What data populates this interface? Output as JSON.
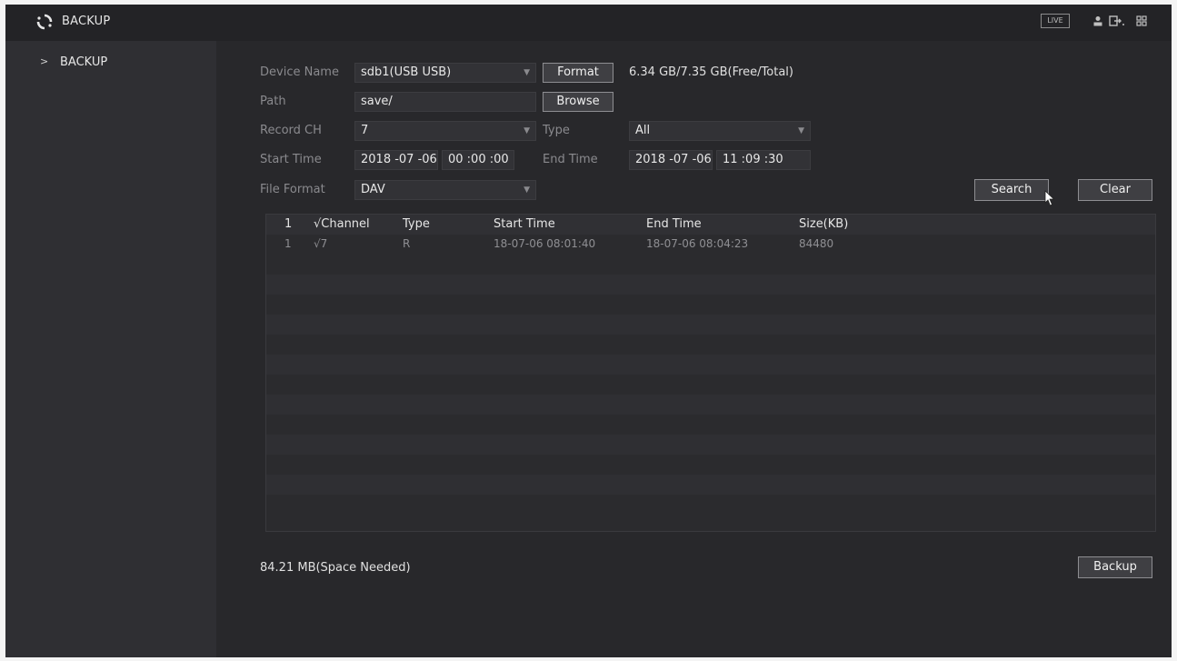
{
  "titlebar": {
    "title": "BACKUP",
    "live_label": "LIVE",
    "icons": [
      "refresh-logo-icon",
      "user-icon",
      "logout-icon",
      "grid-icon"
    ]
  },
  "sidebar": {
    "items": [
      {
        "label": "BACKUP",
        "chevron": ">"
      }
    ]
  },
  "form": {
    "device_name_label": "Device Name",
    "device_name_value": "sdb1(USB USB)",
    "format_button": "Format",
    "capacity_text": "6.34 GB/7.35 GB(Free/Total)",
    "path_label": "Path",
    "path_value": "save/",
    "browse_button": "Browse",
    "record_ch_label": "Record CH",
    "record_ch_value": "7",
    "type_label": "Type",
    "type_value": "All",
    "start_time_label": "Start Time",
    "start_date": "2018 -07 -06",
    "start_time": "00 :00 :00",
    "end_time_label": "End Time",
    "end_date": "2018 -07 -06",
    "end_time": "11 :09 :30",
    "file_format_label": "File Format",
    "file_format_value": "DAV",
    "search_button": "Search",
    "clear_button": "Clear"
  },
  "table": {
    "header": {
      "index": "1",
      "channel": "√Channel",
      "type": "Type",
      "start_time": "Start Time",
      "end_time": "End Time",
      "size": "Size(KB)"
    },
    "rows": [
      {
        "index": "1",
        "channel": "√7",
        "type": "R",
        "start_time": "18-07-06 08:01:40",
        "end_time": "18-07-06 08:04:23",
        "size": "84480"
      }
    ]
  },
  "footer": {
    "space_needed": "84.21 MB(Space Needed)",
    "backup_button": "Backup"
  },
  "colors": {
    "background": "#2b2b2e",
    "titlebar": "#232326",
    "text": "#e6e6e6",
    "muted_label": "#8a8a8e"
  }
}
